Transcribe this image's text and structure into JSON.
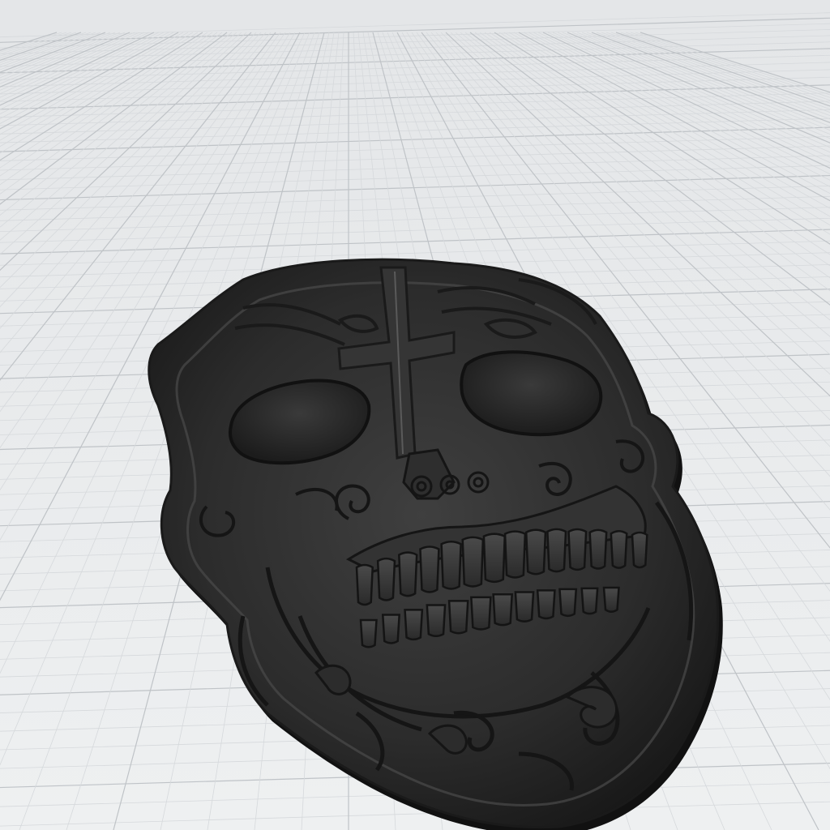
{
  "viewport": {
    "background_color": "#eceeef",
    "grid_minor_color": "#d6d9dc",
    "grid_major_color": "#bfc3c7"
  },
  "model": {
    "kind": "3d-relief-sugar-skull",
    "base_color": "#2b2b2b",
    "highlight_color": "#555555",
    "shadow_color": "#121212"
  }
}
